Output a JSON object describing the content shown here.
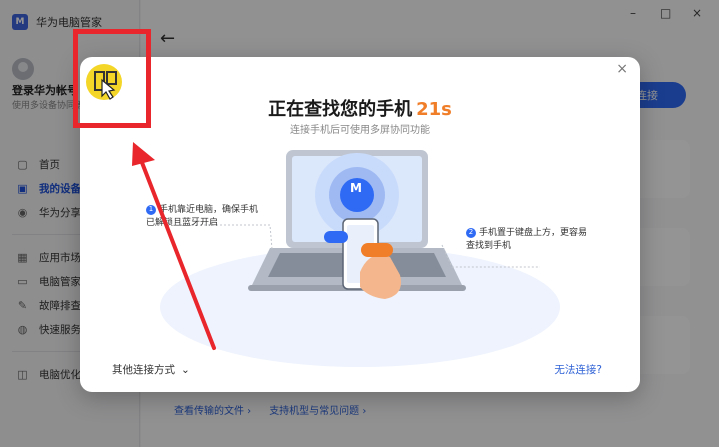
{
  "window": {
    "title": "华为电脑管家",
    "controls": [
      "–",
      "□",
      "×"
    ]
  },
  "user": {
    "login_title": "登录华为帐号",
    "login_sub": "使用多设备协同等功能"
  },
  "sidebar": {
    "items": [
      {
        "label": "首页",
        "icon": "home-icon"
      },
      {
        "label": "我的设备",
        "icon": "devices-icon",
        "active": true
      },
      {
        "label": "华为分享",
        "icon": "share-icon"
      },
      {
        "label": "应用市场",
        "icon": "store-icon"
      },
      {
        "label": "电脑管家",
        "icon": "monitor-icon"
      },
      {
        "label": "故障排查",
        "icon": "wrench-icon"
      },
      {
        "label": "快速服务",
        "icon": "service-icon"
      },
      {
        "label": "电脑优化",
        "icon": "optimize-icon"
      }
    ]
  },
  "main": {
    "connect_label": "连接",
    "bottom_links": [
      "查看传输的文件 ›",
      "支持机型与常见问题 ›"
    ]
  },
  "dialog": {
    "title": "正在查找您的手机",
    "countdown": "21s",
    "subtitle": "连接手机后可使用多屏协同功能",
    "tip1": "手机靠近电脑，确保手机已解锁且蓝牙开启",
    "tip2": "手机置于键盘上方，更容易查找到手机",
    "laptop_logo": "M",
    "other_ways": "其他连接方式",
    "cant_connect": "无法连接?",
    "close": "×"
  },
  "colors": {
    "accent": "#2f6af5",
    "countdown": "#f07d27",
    "highlight": "#e8262b",
    "marker": "#f3d628"
  }
}
